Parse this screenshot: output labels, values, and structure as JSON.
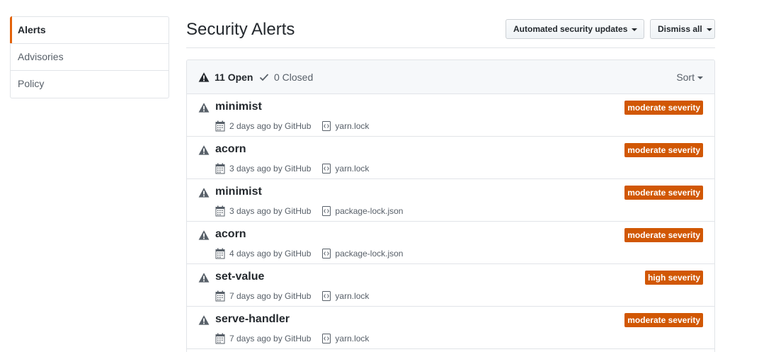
{
  "sidebar": {
    "items": [
      {
        "label": "Alerts"
      },
      {
        "label": "Advisories"
      },
      {
        "label": "Policy"
      }
    ]
  },
  "header": {
    "title": "Security Alerts",
    "automated_updates_label": "Automated security updates",
    "dismiss_all_label": "Dismiss all"
  },
  "box": {
    "open_label": "11 Open",
    "closed_label": "0 Closed",
    "sort_label": "Sort"
  },
  "alerts": [
    {
      "name": "minimist",
      "time": "2 days ago by GitHub",
      "file": "yarn.lock",
      "severity": "moderate severity"
    },
    {
      "name": "acorn",
      "time": "3 days ago by GitHub",
      "file": "yarn.lock",
      "severity": "moderate severity"
    },
    {
      "name": "minimist",
      "time": "3 days ago by GitHub",
      "file": "package-lock.json",
      "severity": "moderate severity"
    },
    {
      "name": "acorn",
      "time": "4 days ago by GitHub",
      "file": "package-lock.json",
      "severity": "moderate severity"
    },
    {
      "name": "set-value",
      "time": "7 days ago by GitHub",
      "file": "yarn.lock",
      "severity": "high severity"
    },
    {
      "name": "serve-handler",
      "time": "7 days ago by GitHub",
      "file": "yarn.lock",
      "severity": "moderate severity"
    }
  ],
  "colors": {
    "accent": "#e36209",
    "severity_badge": "#d15704"
  }
}
